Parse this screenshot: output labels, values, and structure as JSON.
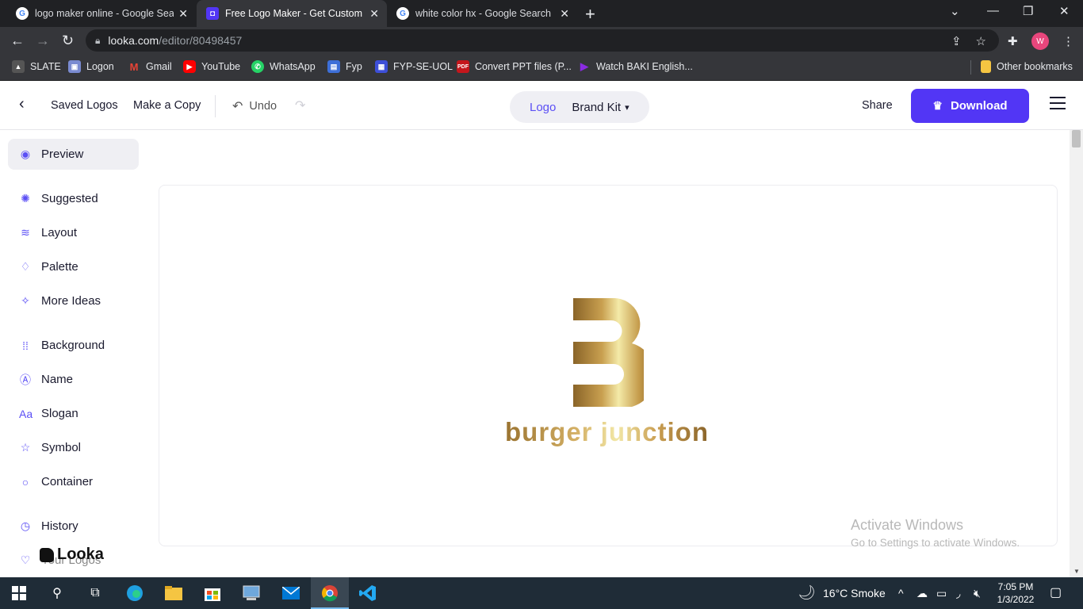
{
  "browser": {
    "tabs": [
      {
        "title": "logo maker online - Google Sear",
        "icon": "google-icon"
      },
      {
        "title": "Free Logo Maker - Get Custom Lo",
        "icon": "looka-icon"
      },
      {
        "title": "white color hx - Google Search",
        "icon": "google-icon"
      }
    ],
    "url_host": "looka.com",
    "url_path": "/editor/80498457",
    "profile_initial": "W",
    "bookmarks": [
      {
        "label": "SLATE",
        "icon": "slate-icon"
      },
      {
        "label": "Logon",
        "icon": "logon-icon"
      },
      {
        "label": "Gmail",
        "icon": "gmail-icon"
      },
      {
        "label": "YouTube",
        "icon": "youtube-icon"
      },
      {
        "label": "WhatsApp",
        "icon": "whatsapp-icon"
      },
      {
        "label": "Fyp",
        "icon": "fyp-icon"
      },
      {
        "label": "FYP-SE-UOL",
        "icon": "fyp-se-uol-icon"
      },
      {
        "label": "Convert PPT files (P...",
        "icon": "pdf-icon"
      },
      {
        "label": "Watch BAKI English...",
        "icon": "play-icon"
      }
    ],
    "other_bookmarks": "Other bookmarks"
  },
  "header": {
    "saved_logos": "Saved Logos",
    "make_copy": "Make a Copy",
    "undo": "Undo",
    "switch_logo": "Logo",
    "switch_brand_kit": "Brand Kit",
    "share": "Share",
    "download": "Download"
  },
  "sidebar": {
    "items": [
      {
        "label": "Preview",
        "icon": "eye-icon"
      },
      {
        "label": "Suggested",
        "icon": "lightbulb-icon"
      },
      {
        "label": "Layout",
        "icon": "layers-icon"
      },
      {
        "label": "Palette",
        "icon": "droplet-icon"
      },
      {
        "label": "More Ideas",
        "icon": "magic-wand-icon"
      },
      {
        "label": "Background",
        "icon": "background-icon"
      },
      {
        "label": "Name",
        "icon": "text-box-icon"
      },
      {
        "label": "Slogan",
        "icon": "slogan-icon"
      },
      {
        "label": "Symbol",
        "icon": "star-icon"
      },
      {
        "label": "Container",
        "icon": "circle-icon"
      },
      {
        "label": "History",
        "icon": "history-icon"
      },
      {
        "label": "Your Logos",
        "icon": "heart-icon"
      }
    ],
    "brand": "Looka"
  },
  "canvas": {
    "logo_name": "burger junction",
    "gold_dark": "#9a7330",
    "gold_light": "#f2e7a6"
  },
  "watermark": {
    "line1": "Activate Windows",
    "line2": "Go to Settings to activate Windows."
  },
  "taskbar": {
    "weather": "16°C  Smoke",
    "time": "7:05 PM",
    "date": "1/3/2022"
  },
  "colors": {
    "accent": "#5236f5",
    "link": "#5b4ff5"
  }
}
